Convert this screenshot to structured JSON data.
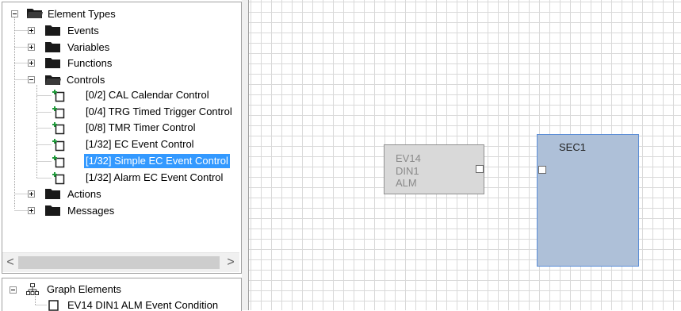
{
  "tree": {
    "root": {
      "label": "Element Types"
    },
    "items": [
      {
        "label": "Events",
        "expander": "+"
      },
      {
        "label": "Variables",
        "expander": "+"
      },
      {
        "label": "Functions",
        "expander": "+"
      },
      {
        "label": "Controls",
        "expander": "-"
      },
      {
        "label": "Actions",
        "expander": "+"
      },
      {
        "label": "Messages",
        "expander": "+"
      }
    ],
    "controls": [
      {
        "label": "[0/2] CAL Calendar Control",
        "selected": false
      },
      {
        "label": "[0/4] TRG Timed Trigger Control",
        "selected": false
      },
      {
        "label": "[0/8] TMR Timer Control",
        "selected": false
      },
      {
        "label": "[1/32] EC Event Control",
        "selected": false
      },
      {
        "label": "[1/32] Simple EC Event Control",
        "selected": true
      },
      {
        "label": "[1/32] Alarm EC Event Control",
        "selected": false
      }
    ],
    "scroll_left": "<",
    "scroll_right": ">"
  },
  "graph": {
    "root": {
      "label": "Graph Elements"
    },
    "child": {
      "label": "EV14 DIN1 ALM Event Condition"
    }
  },
  "canvas": {
    "ev_node": {
      "lines": [
        "EV14",
        "DIN1",
        "ALM"
      ]
    },
    "sec_node": {
      "title": "SEC1"
    }
  },
  "colors": {
    "selection": "#3399ff",
    "sec_node_fill": "#aec0d8",
    "sec_node_border": "#5b8dd6",
    "ev_node_fill": "#d9d9d9",
    "grid": "#d9d9d9"
  },
  "icons": {
    "folder": "folder-icon",
    "control": "control-item-icon",
    "graph": "hierarchy-icon"
  }
}
